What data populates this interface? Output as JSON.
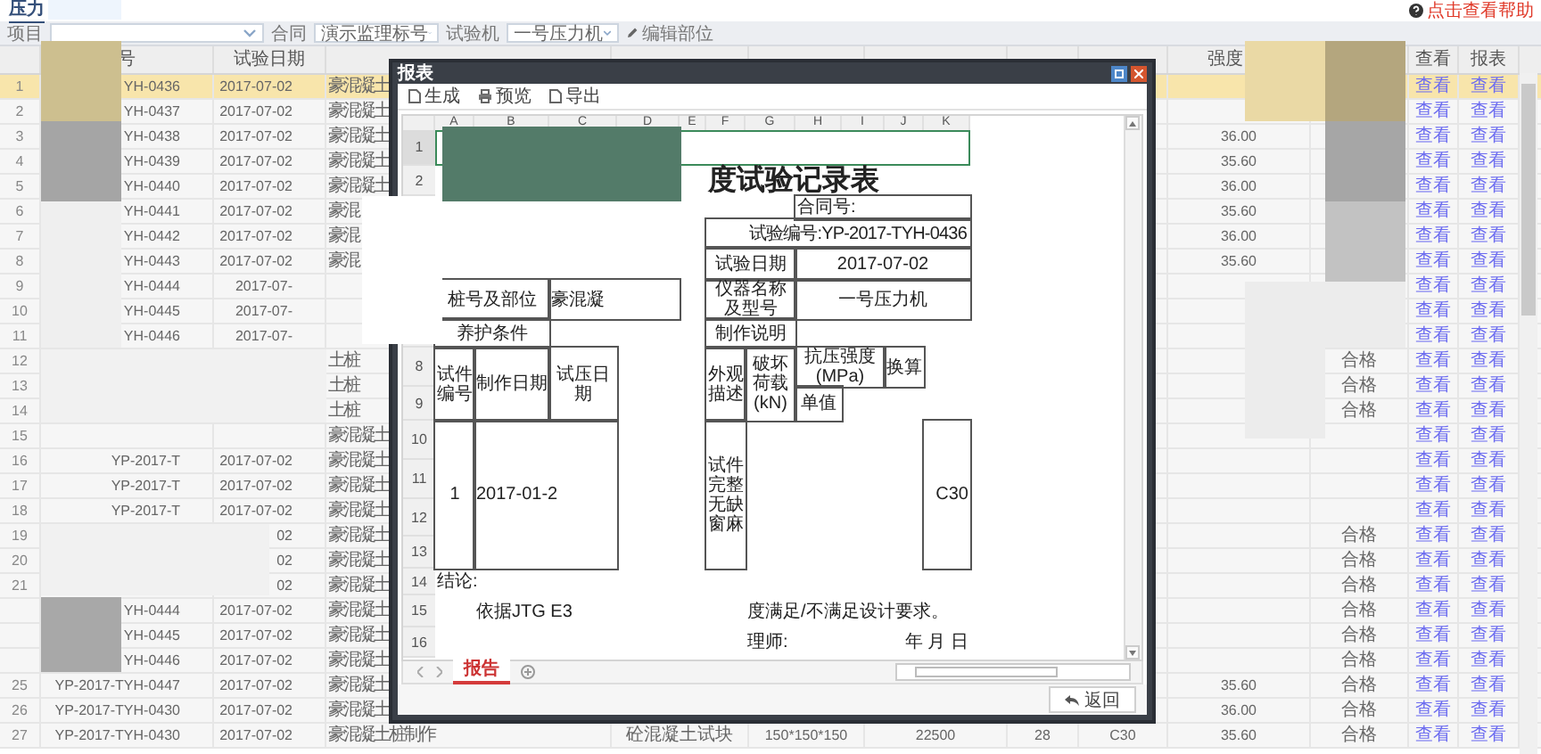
{
  "app_tab": {
    "label": "压力",
    "selected": true
  },
  "help_link": "点击查看帮助",
  "filters": [
    {
      "label": "项目"
    },
    {
      "label": "合同",
      "value": "演示监理标号"
    },
    {
      "label": "试验机",
      "value": "一号压力机"
    }
  ],
  "edit_button": "编辑部位",
  "table": {
    "headers": {
      "code": "号",
      "date": "试验日期",
      "strength": "强度",
      "view": "查看",
      "report": "报表"
    },
    "rows": [
      {
        "n": "1",
        "code": "YH-0436",
        "date": "2017-07-02",
        "part": "豪混凝土",
        "view": "查看",
        "report": "查看",
        "selected": true
      },
      {
        "n": "2",
        "code": "YH-0437",
        "date": "2017-07-02",
        "part": "豪混凝土",
        "view": "查看",
        "report": "查看",
        "selected": false
      },
      {
        "n": "3",
        "code": "YH-0438",
        "date": "2017-07-02",
        "part": "豪混凝土",
        "strength": "36.00",
        "view": "查看",
        "report": "查看",
        "selected": false
      },
      {
        "n": "4",
        "code": "YH-0439",
        "date": "2017-07-02",
        "part": "豪混凝土",
        "strength": "35.60",
        "view": "查看",
        "report": "查看",
        "selected": false
      },
      {
        "n": "5",
        "code": "YH-0440",
        "date": "2017-07-02",
        "part": "豪混凝土",
        "strength": "36.00",
        "view": "查看",
        "report": "查看",
        "selected": false
      },
      {
        "n": "6",
        "code": "YH-0441",
        "date": "2017-07-02",
        "part": "豪混",
        "strength": "35.60",
        "view": "查看",
        "report": "查看",
        "selected": false
      },
      {
        "n": "7",
        "code": "YH-0442",
        "date": "2017-07-02",
        "part": "豪混",
        "strength": "36.00",
        "view": "查看",
        "report": "查看",
        "selected": false
      },
      {
        "n": "8",
        "code": "YH-0443",
        "date": "2017-07-02",
        "part": "豪混",
        "strength": "35.60",
        "view": "查看",
        "report": "查看",
        "selected": false
      },
      {
        "n": "9",
        "code": "YH-0444",
        "date": "2017-07-",
        "view": "查看",
        "report": "查看",
        "selected": false
      },
      {
        "n": "10",
        "code": "YH-0445",
        "date": "2017-07-",
        "view": "查看",
        "report": "查看",
        "selected": false
      },
      {
        "n": "11",
        "code": "YH-0446",
        "date": "2017-07-",
        "view": "查看",
        "report": "查看",
        "selected": false
      },
      {
        "n": "12",
        "part": "土桩",
        "result": "合格",
        "view": "查看",
        "report": "查看",
        "selected": false
      },
      {
        "n": "13",
        "part": "土桩",
        "result": "合格",
        "view": "查看",
        "report": "查看",
        "selected": false
      },
      {
        "n": "14",
        "part": "土桩",
        "result": "合格",
        "view": "查看",
        "report": "查看",
        "selected": false
      },
      {
        "n": "15",
        "part": "豪混凝土",
        "view": "查看",
        "report": "查看",
        "selected": false
      },
      {
        "n": "16",
        "code": "YP-2017-T",
        "date": "2017-07-02",
        "part": "豪混凝土",
        "view": "查看",
        "report": "查看",
        "selected": false
      },
      {
        "n": "17",
        "code": "YP-2017-T",
        "date": "2017-07-02",
        "part": "豪混凝土",
        "view": "查看",
        "report": "查看",
        "selected": false
      },
      {
        "n": "18",
        "code": "YP-2017-T",
        "date": "2017-07-02",
        "part": "豪混凝土",
        "view": "查看",
        "report": "查看",
        "selected": false
      },
      {
        "n": "19",
        "date": "02",
        "part": "豪混凝土",
        "result": "合格",
        "view": "查看",
        "report": "查看",
        "selected": false
      },
      {
        "n": "20",
        "date": "02",
        "part": "豪混凝土",
        "result": "合格",
        "view": "查看",
        "report": "查看",
        "selected": false
      },
      {
        "n": "21",
        "date": "02",
        "part": "豪混凝土",
        "result": "合格",
        "view": "查看",
        "report": "查看",
        "selected": false
      },
      {
        "code": "YH-0444",
        "date": "2017-07-02",
        "part": "豪混凝土",
        "result": "合格",
        "view": "查看",
        "report": "查看",
        "selected": false
      },
      {
        "code": "YH-0445",
        "date": "2017-07-02",
        "part": "豪混凝土",
        "result": "合格",
        "view": "查看",
        "report": "查看",
        "selected": false
      },
      {
        "code": "YH-0446",
        "date": "2017-07-02",
        "part": "豪混凝土",
        "result": "合格",
        "view": "查看",
        "report": "查看",
        "selected": false
      },
      {
        "n": "25",
        "code": "YP-2017-TYH-0447",
        "date": "2017-07-02",
        "part": "豪混凝土",
        "strength": "35.60",
        "result": "合格",
        "view": "查看",
        "report": "查看",
        "selected": false
      },
      {
        "n": "26",
        "code": "YP-2017-TYH-0430",
        "date": "2017-07-02",
        "part": "豪混凝土",
        "strength": "36.00",
        "result": "合格",
        "view": "查看",
        "report": "查看",
        "selected": false
      },
      {
        "n": "27",
        "code": "YP-2017-TYH-0430",
        "date": "2017-07-02",
        "part": "豪混凝土桩制作",
        "desc": "砼混凝土试块",
        "spec": "150*150*150",
        "area": "22500",
        "age": "28",
        "design": "C30",
        "strength": "35.60",
        "result": "合格",
        "view": "查看",
        "report": "查看",
        "selected": false
      }
    ]
  },
  "dialog": {
    "title": "报表",
    "toolbar": [
      "生成",
      "预览",
      "导出"
    ],
    "column_letters": [
      "A",
      "B",
      "C",
      "D",
      "E",
      "F",
      "G",
      "H",
      "I",
      "J",
      "K"
    ],
    "row_numbers": [
      "1",
      "2",
      "8",
      "9",
      "10",
      "11",
      "12",
      "13",
      "14",
      "15",
      "16"
    ],
    "cells": [
      "度试验记录表",
      "合同号:",
      "试验编号:YP-2017-TYH-0436",
      "试验日期",
      "2017-07-02",
      "桩号及部位",
      "豪混凝",
      "仪器名称及型号",
      "一号压力机",
      "养护条件",
      "制作说明",
      "试件编号",
      "制作日期",
      "试压日期",
      "外观描述",
      "破坏荷载(kN)",
      "抗压强度(MPa)",
      "换算",
      "单值",
      "1",
      "2017-01-2",
      "试件完整无缺窗麻",
      "C30",
      "结论:",
      "依据JTG E3",
      "度满足/不满足设计要求。",
      "理师:",
      "年 月 日"
    ],
    "sheet_tabs": [
      {
        "label": "报告",
        "selected": true
      }
    ],
    "back_button": "返回"
  }
}
